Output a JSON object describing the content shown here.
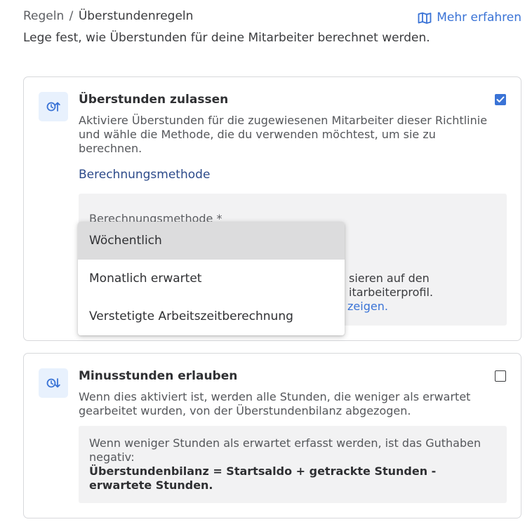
{
  "header": {
    "breadcrumb_parent": "Regeln",
    "breadcrumb_separator": "/",
    "breadcrumb_current": "Überstundenregeln",
    "learn_more_label": "Mehr erfahren",
    "learn_more_icon": "book-map-icon",
    "subtitle": "Lege fest, wie Überstunden für deine Mitarbeiter berechnet werden."
  },
  "overtime_card": {
    "icon": "clock-arrow-up-icon",
    "title": "Überstunden zulassen",
    "description": "Aktiviere Überstunden für die zugewiesenen Mitarbeiter dieser Richtlinie und wähle die Methode, die du verwenden möchtest, um sie zu berechnen.",
    "checked": true,
    "section_label": "Berechnungsmethode",
    "field_label": "Berechnungsmethode *",
    "help_text_visible": "sieren auf den",
    "help_text_visible_2": "itarbeiterprofil.",
    "help_link_visible": "zeigen."
  },
  "dropdown": {
    "options": [
      {
        "label": "Wöchentlich",
        "selected": true
      },
      {
        "label": "Monatlich erwartet",
        "selected": false
      },
      {
        "label": "Verstetigte Arbeitszeitberechnung",
        "selected": false
      }
    ]
  },
  "minus_card": {
    "icon": "clock-arrow-down-icon",
    "title": "Minusstunden erlauben",
    "description": "Wenn dies aktiviert ist, werden alle Stunden, die weniger als erwartet gearbeitet wurden, von der Überstundenbilanz abgezogen.",
    "checked": false,
    "note": "Wenn weniger Stunden als erwartet erfasst werden, ist das Guthaben negativ:",
    "formula": "Überstundenbilanz = Startsaldo + getrackte Stunden - erwartete Stunden."
  },
  "colors": {
    "accent": "#3a73d6",
    "icon_bg": "#e8f1fd",
    "section_link": "#2c4a8a",
    "grey_box": "#f2f2f3",
    "selected_option": "#dcdcdd"
  }
}
